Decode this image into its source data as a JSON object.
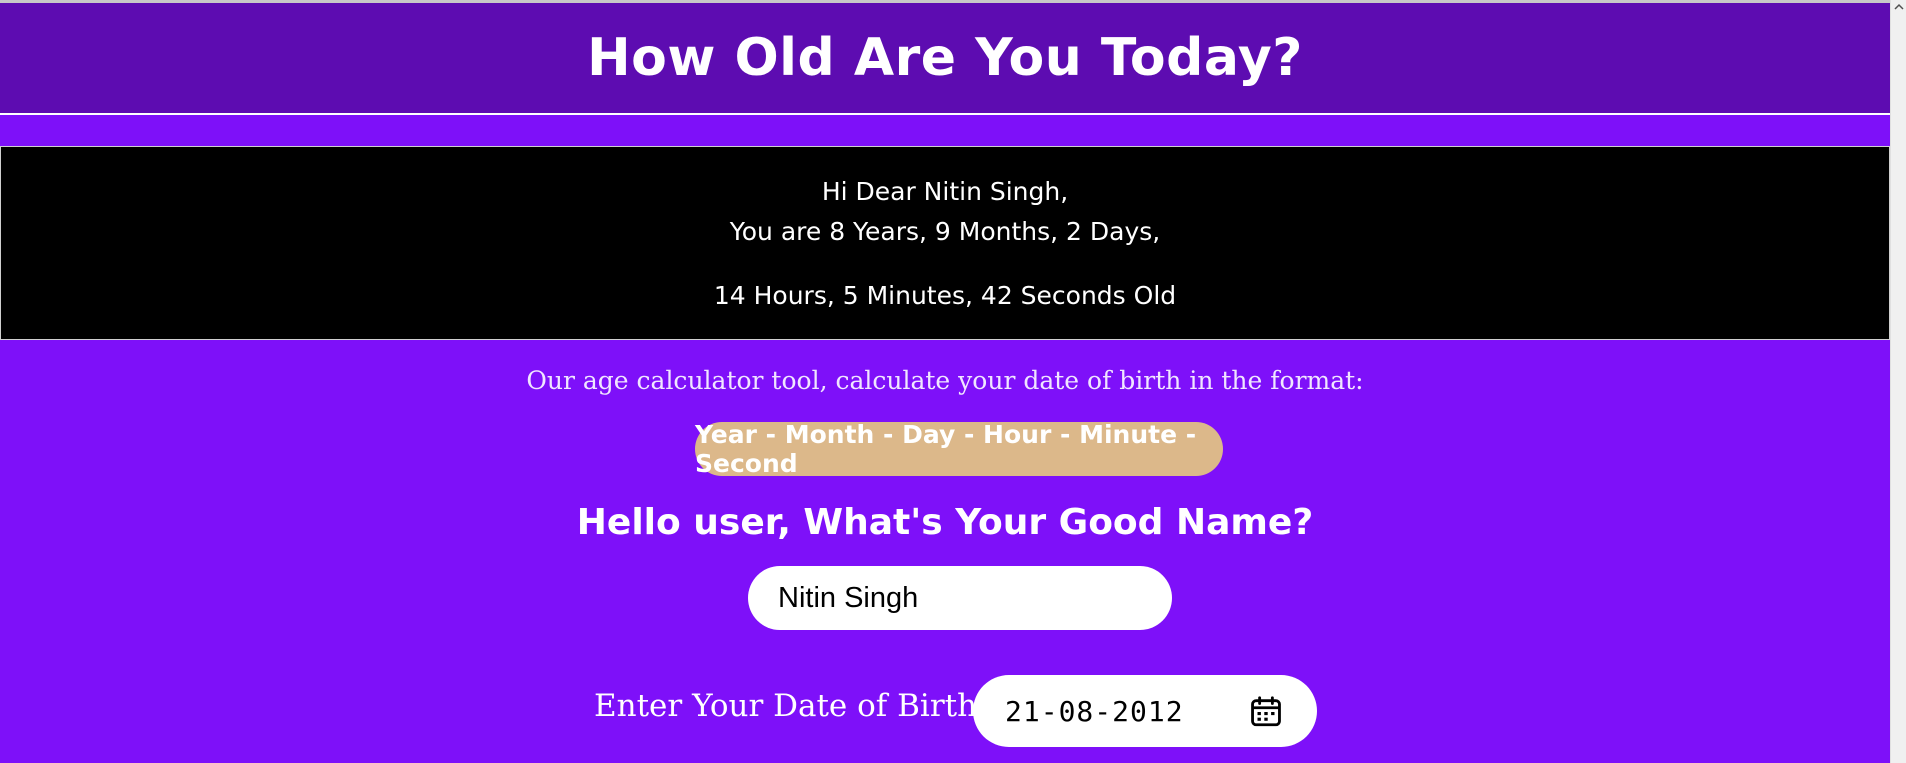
{
  "header": {
    "title": "How Old Are You Today?"
  },
  "result": {
    "greeting": "Hi Dear Nitin Singh,",
    "line_ymd": "You are 8 Years, 9 Months, 2 Days,",
    "line_hms": "14 Hours, 5 Minutes, 42 Seconds Old"
  },
  "info": {
    "text": "Our age calculator tool, calculate your date of birth in the format:",
    "format": "Year - Month - Day - Hour - Minute - Second"
  },
  "name_section": {
    "question": "Hello user, What's Your Good Name?",
    "value": "Nitin Singh"
  },
  "dob_section": {
    "label": "Enter Your Date of Birth:",
    "value": "21-08-2012",
    "icon": "calendar-icon"
  },
  "colors": {
    "background": "#7e10f9",
    "header": "#5d0cb1",
    "result_box": "#000000",
    "format_pill": "#dcb88a"
  }
}
